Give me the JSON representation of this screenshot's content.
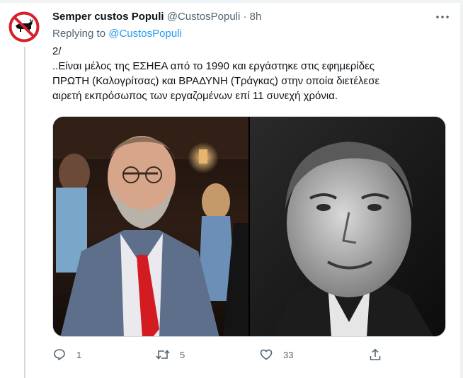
{
  "tweet": {
    "author_name": "Semper custos Populi",
    "author_handle": "@CustosPopuli",
    "separator": "·",
    "time": "8h",
    "reply_prefix": "Replying to",
    "reply_mention": "@CustosPopuli",
    "text_lines": [
      "2/",
      "..Είναι μέλος της ΕΣΗΕΑ από το 1990 και εργάστηκε στις εφημερίδες",
      "ΠΡΩΤΗ (Καλογρίτσας) και ΒΡΑΔΥΝΗ (Τράγκας) στην οποία διετέλεσε",
      "αιρετή εκπρόσωπος των εργαζομένων επί 11 συνεχή χρόνια."
    ],
    "media": [
      {
        "icon": "photo-color-bearded-man-red-tie"
      },
      {
        "icon": "photo-bw-man-portrait"
      }
    ]
  },
  "actions": {
    "reply_count": "1",
    "retweet_count": "5",
    "like_count": "33"
  },
  "colors": {
    "accent": "#1d9bf0",
    "muted_text": "#536471",
    "primary_text": "#0f1419",
    "avatar_red": "#d6202a"
  }
}
